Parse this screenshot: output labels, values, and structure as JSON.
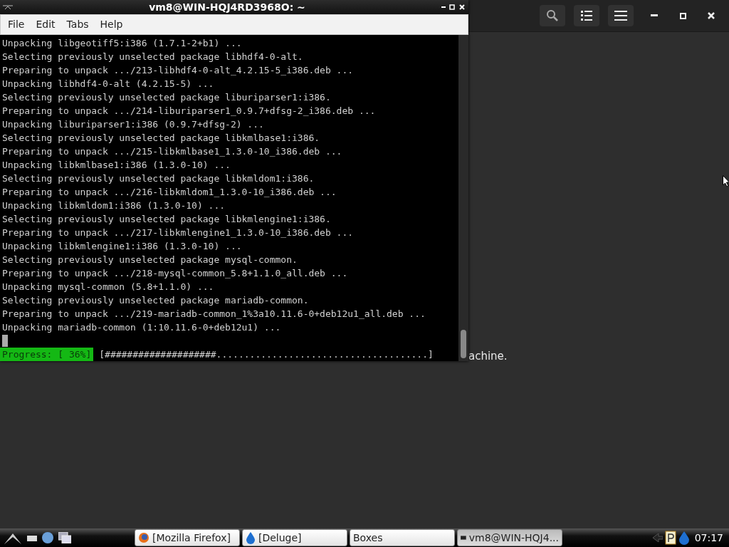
{
  "boxes_window": {
    "partial_text": "achine."
  },
  "terminal": {
    "title": "vm8@WIN-HQJ4RD3968O: ~",
    "menu": [
      "File",
      "Edit",
      "Tabs",
      "Help"
    ],
    "lines": [
      "Unpacking libgeotiff5:i386 (1.7.1-2+b1) ...",
      "Selecting previously unselected package libhdf4-0-alt.",
      "Preparing to unpack .../213-libhdf4-0-alt_4.2.15-5_i386.deb ...",
      "Unpacking libhdf4-0-alt (4.2.15-5) ...",
      "Selecting previously unselected package liburiparser1:i386.",
      "Preparing to unpack .../214-liburiparser1_0.9.7+dfsg-2_i386.deb ...",
      "Unpacking liburiparser1:i386 (0.9.7+dfsg-2) ...",
      "Selecting previously unselected package libkmlbase1:i386.",
      "Preparing to unpack .../215-libkmlbase1_1.3.0-10_i386.deb ...",
      "Unpacking libkmlbase1:i386 (1.3.0-10) ...",
      "Selecting previously unselected package libkmldom1:i386.",
      "Preparing to unpack .../216-libkmldom1_1.3.0-10_i386.deb ...",
      "Unpacking libkmldom1:i386 (1.3.0-10) ...",
      "Selecting previously unselected package libkmlengine1:i386.",
      "Preparing to unpack .../217-libkmlengine1_1.3.0-10_i386.deb ...",
      "Unpacking libkmlengine1:i386 (1.3.0-10) ...",
      "Selecting previously unselected package mysql-common.",
      "Preparing to unpack .../218-mysql-common_5.8+1.1.0_all.deb ...",
      "Unpacking mysql-common (5.8+1.1.0) ...",
      "Selecting previously unselected package mariadb-common.",
      "Preparing to unpack .../219-mariadb-common_1%3a10.11.6-0+deb12u1_all.deb ...",
      "Unpacking mariadb-common (1:10.11.6-0+deb12u1) ..."
    ],
    "progress_label": "Progress: [ 36%]",
    "progress_bar": "[####################......................................]"
  },
  "taskbar": {
    "tasks": [
      {
        "kind": "browser",
        "label": "[Mozilla Firefox]",
        "selected": false
      },
      {
        "kind": "torrent",
        "label": "[Deluge]",
        "selected": false
      },
      {
        "kind": "plain",
        "label": "Boxes",
        "selected": false
      },
      {
        "kind": "terminal",
        "label": "vm8@WIN-HQJ4...",
        "selected": true
      }
    ],
    "clock": "07:17"
  }
}
